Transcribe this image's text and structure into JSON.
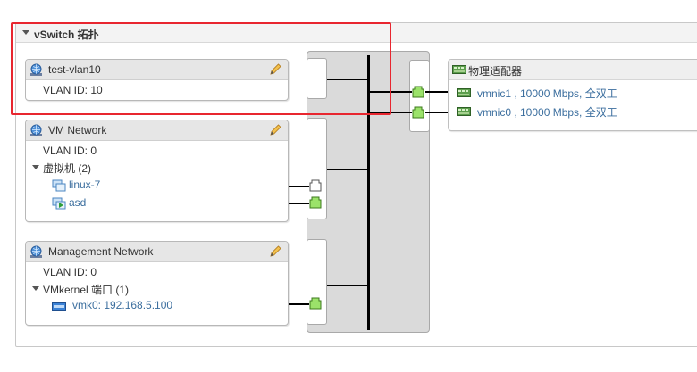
{
  "panel": {
    "title": "vSwitch 拓扑"
  },
  "port_groups": [
    {
      "name": "test-vlan10",
      "vlan": "VLAN ID: 10"
    },
    {
      "name": "VM Network",
      "vlan": "VLAN ID: 0",
      "section_label": "虚拟机 (2)",
      "items": [
        "linux-7",
        "asd"
      ]
    },
    {
      "name": "Management Network",
      "vlan": "VLAN ID: 0",
      "section_label": "VMkernel 端口 (1)",
      "items": [
        "vmk0: 192.168.5.100"
      ]
    }
  ],
  "physical_adapters": {
    "title": "物理适配器",
    "items": [
      "vmnic1 , 10000 Mbps, 全双工",
      "vmnic0 , 10000 Mbps, 全双工"
    ]
  },
  "colors": {
    "highlight": "#e8262f",
    "port_green": "#9be26a",
    "link": "#3b6e9e"
  }
}
